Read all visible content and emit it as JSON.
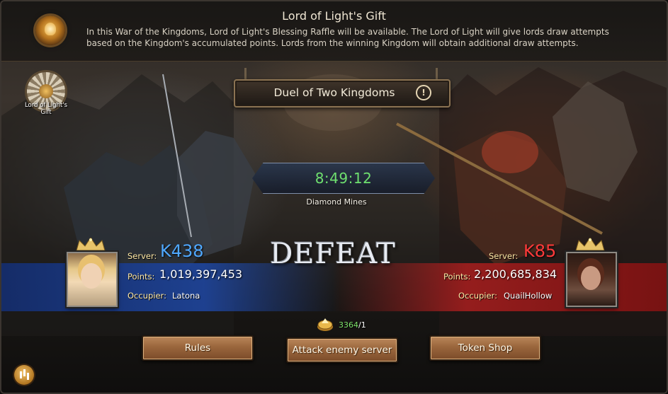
{
  "banner": {
    "title": "Lord of Light's Gift",
    "description": "In this War of the Kingdoms, Lord of Light's Blessing Raffle will be available. The Lord of Light will give lords draw attempts based on the Kingdom's accumulated points. Lords from the winning Kingdom will obtain additional draw attempts."
  },
  "side_icon": {
    "label": "Lord of Light's Gift"
  },
  "duel": {
    "title": "Duel of Two Kingdoms",
    "info_icon": "!"
  },
  "timer": {
    "value": "8:49:12",
    "location": "Diamond Mines"
  },
  "result": "DEFEAT",
  "left_kingdom": {
    "server_label": "Server:",
    "server": "K438",
    "points_label": "Points:",
    "points": "1,019,397,453",
    "occupier_label": "Occupier:",
    "occupier": "Latona",
    "color": "#4fa8ff"
  },
  "right_kingdom": {
    "server_label": "Server:",
    "server": "K85",
    "points_label": "Points:",
    "points": "2,200,685,834",
    "occupier_label": "Occupier:",
    "occupier": "QuailHollow",
    "color": "#ff3a3a"
  },
  "tokens": {
    "count": "3364",
    "suffix": "/1",
    "icon": "token-icon"
  },
  "buttons": {
    "rules": "Rules",
    "attack": "Attack enemy server",
    "token_shop": "Token Shop"
  }
}
